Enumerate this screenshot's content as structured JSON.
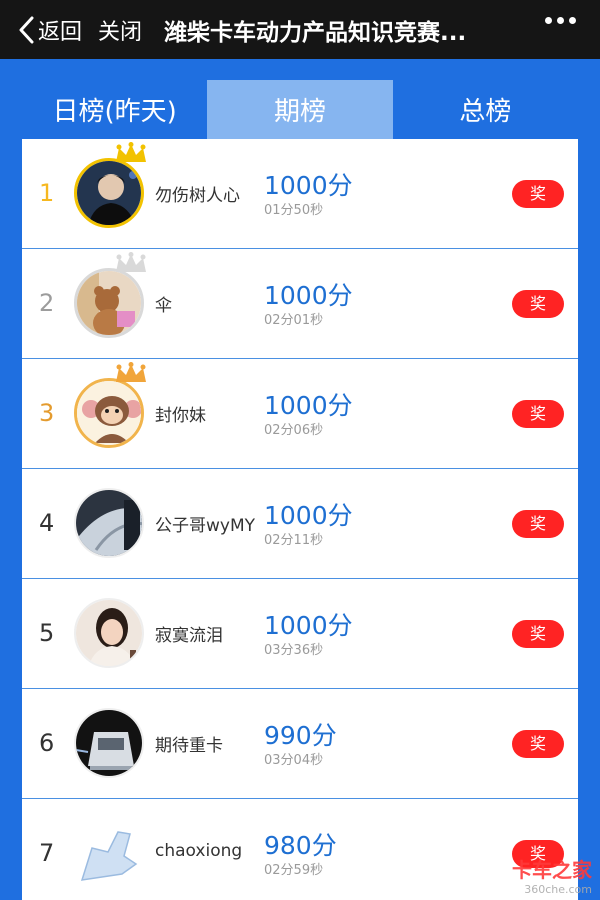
{
  "navbar": {
    "back_label": "返回",
    "close_label": "关闭",
    "title": "潍柴卡车动力产品知识竞赛..."
  },
  "tabs": [
    {
      "label": "日榜(昨天)",
      "active": false
    },
    {
      "label": "期榜",
      "active": true
    },
    {
      "label": "总榜",
      "active": false
    }
  ],
  "leaderboard": [
    {
      "rank": "1",
      "name": "勿伤树人心",
      "score": "1000分",
      "time": "01分50秒",
      "prize": "奖"
    },
    {
      "rank": "2",
      "name": "伞",
      "score": "1000分",
      "time": "02分01秒",
      "prize": "奖"
    },
    {
      "rank": "3",
      "name": "封你妹",
      "score": "1000分",
      "time": "02分06秒",
      "prize": "奖"
    },
    {
      "rank": "4",
      "name": "公子哥wyMY",
      "score": "1000分",
      "time": "02分11秒",
      "prize": "奖"
    },
    {
      "rank": "5",
      "name": "寂寞流泪",
      "score": "1000分",
      "time": "03分36秒",
      "prize": "奖"
    },
    {
      "rank": "6",
      "name": "期待重卡",
      "score": "990分",
      "time": "03分04秒",
      "prize": "奖"
    },
    {
      "rank": "7",
      "name": "chaoxiong",
      "score": "980分",
      "time": "02分59秒",
      "prize": "奖"
    }
  ],
  "watermark": {
    "logo_text": "卡车之家",
    "sub_text": "360che.com"
  },
  "colors": {
    "navbar": "#151515",
    "background": "#1f6fe0",
    "active_tab": "#86b5f0",
    "score": "#1e6fd2",
    "prize": "#ff2323",
    "gold": "#f6b820",
    "silver": "#9c9c9c",
    "bronze": "#e49b2e"
  }
}
